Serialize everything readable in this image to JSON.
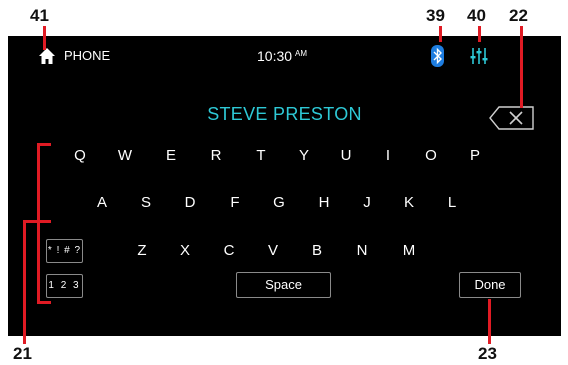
{
  "callouts": {
    "home": "41",
    "bluetooth": "39",
    "eq": "40",
    "backspace": "22",
    "keyboard": "21",
    "done": "23"
  },
  "status_bar": {
    "source_label": "PHONE",
    "time": "10:30",
    "ampm": "AM"
  },
  "contact_name": "STEVE PRESTON",
  "keyboard": {
    "row1": [
      "Q",
      "W",
      "E",
      "R",
      "T",
      "Y",
      "U",
      "I",
      "O",
      "P"
    ],
    "row2": [
      "A",
      "S",
      "D",
      "F",
      "G",
      "H",
      "J",
      "K",
      "L"
    ],
    "row3": [
      "Z",
      "X",
      "C",
      "V",
      "B",
      "N",
      "M"
    ],
    "symbols_label": "* ! # ?",
    "numbers_label": "1 2 3",
    "space_label": "Space",
    "done_label": "Done"
  },
  "colors": {
    "accent_cyan": "#2ec9d6",
    "bluetooth_blue": "#1e7de0",
    "callout_red": "#e01b24"
  },
  "icons": {
    "home": "home-icon",
    "bluetooth": "bluetooth-icon",
    "eq": "equalizer-icon",
    "backspace": "backspace-icon"
  }
}
